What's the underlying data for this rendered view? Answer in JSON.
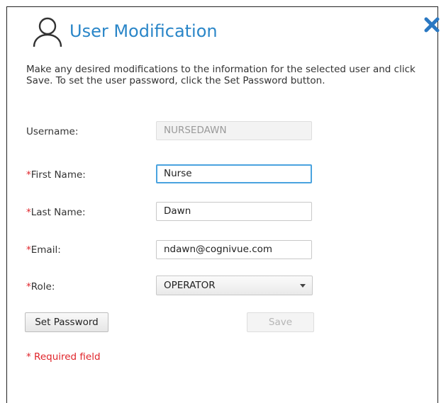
{
  "dialog": {
    "title": "User Modification",
    "icon": "user-icon",
    "close_icon": "close-icon",
    "description": "Make any desired modifications to the information for the selected user and click Save. To set the user password, click the Set Password button.",
    "accent_color": "#2a86c8",
    "required_color": "#e0242a"
  },
  "form": {
    "required_marker": "*",
    "username": {
      "label": "Username:",
      "value": "NURSEDAWN"
    },
    "first_name": {
      "label": "First Name:",
      "value": "Nurse"
    },
    "last_name": {
      "label": "Last Name:",
      "value": "Dawn"
    },
    "email": {
      "label": "Email:",
      "value": "ndawn@cognivue.com"
    },
    "role": {
      "label": "Role:",
      "value": "OPERATOR"
    }
  },
  "buttons": {
    "set_password": "Set Password",
    "save": "Save"
  },
  "footer": {
    "required_note": "* Required field"
  }
}
